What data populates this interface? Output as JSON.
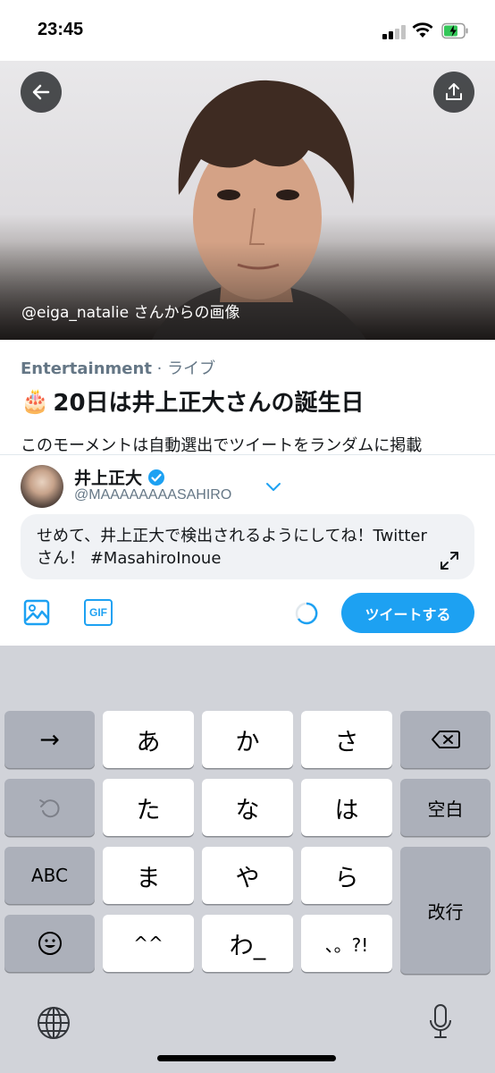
{
  "status_bar": {
    "time": "23:45"
  },
  "hero": {
    "caption": "@eiga_natalie さんからの画像"
  },
  "moment": {
    "category": "Entertainment",
    "separator": " · ",
    "state": "ライブ",
    "title_emoji": "🎂",
    "title": "20日は井上正大さんの誕生日",
    "description": "このモーメントは自動選出でツイートをランダムに掲載"
  },
  "compose": {
    "user_name": "井上正大",
    "user_handle": "@MAAAAAAAASAHIRO",
    "tweet_text": "せめて、井上正大で検出されるようにしてね！Twitterさん！ #MasahiroInoue",
    "gif_label": "GIF",
    "tweet_button": "ツイートする"
  },
  "keyboard": {
    "rows": [
      [
        "→",
        "あ",
        "か",
        "さ",
        "⌫"
      ],
      [
        "↺",
        "た",
        "な",
        "は",
        "空白"
      ],
      [
        "ABC",
        "ま",
        "や",
        "ら",
        "改行"
      ],
      [
        "☺",
        "^^",
        "わ",
        "、。?!"
      ]
    ],
    "key_arrow": "→",
    "key_a": "あ",
    "key_ka": "か",
    "key_sa": "さ",
    "key_ta": "た",
    "key_na": "な",
    "key_ha": "は",
    "key_space": "空白",
    "key_abc": "ABC",
    "key_ma": "ま",
    "key_ya": "や",
    "key_ra": "ら",
    "key_return": "改行",
    "key_caret": "^^",
    "key_wa": "わ_",
    "key_punct": "、。?!"
  },
  "colors": {
    "accent": "#1da1f2",
    "secondary_text": "#657786",
    "keyboard_bg": "#d1d3d9"
  },
  "battery_level": 0.6,
  "signal_bars_filled": 2
}
